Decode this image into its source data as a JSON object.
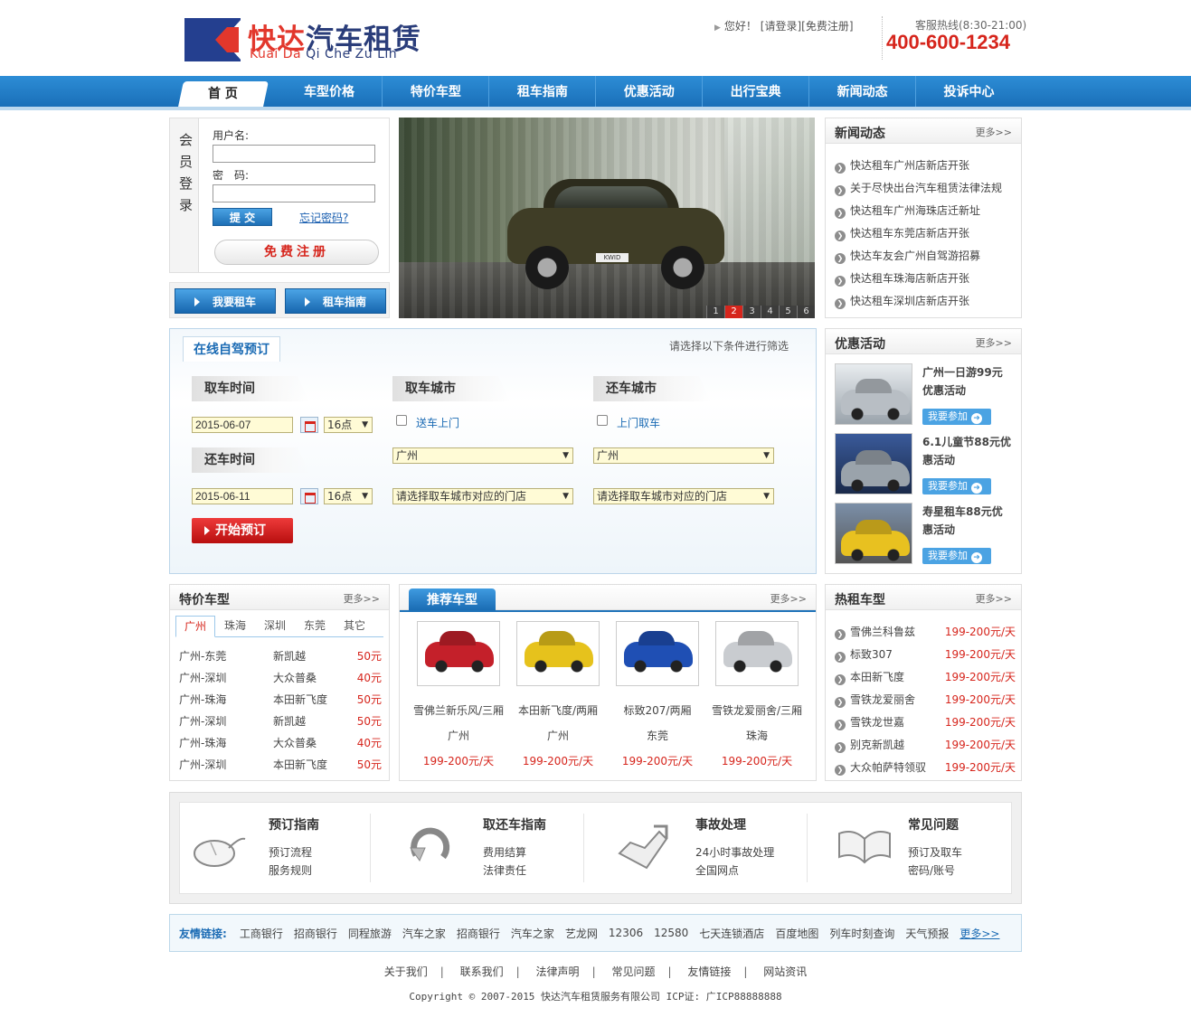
{
  "header": {
    "logo_cn_a": "快达",
    "logo_cn_b": "汽车租赁",
    "logo_en_a": "Kuai Da",
    "logo_en_b": "Qi Che Zu Lin",
    "greeting": "您好！",
    "login_link": "[请登录]",
    "register_link": "[免费注册]",
    "hotline_label": "客服热线(8:30-21:00)",
    "hotline_number": "400-600-1234"
  },
  "nav": [
    "首 页",
    "车型价格",
    "特价车型",
    "租车指南",
    "优惠活动",
    "出行宝典",
    "新闻动态",
    "投诉中心"
  ],
  "login": {
    "side_title": [
      "会",
      "员",
      "登",
      "录"
    ],
    "username_label": "用户名:",
    "password_label": "密　码:",
    "submit": "提 交",
    "forgot": "忘记密码?",
    "register": "免费注册"
  },
  "quick": {
    "rent": "我要租车",
    "guide": "租车指南"
  },
  "banner": {
    "plate": "KWID",
    "pages": [
      "1",
      "2",
      "3",
      "4",
      "5",
      "6"
    ],
    "active_page": "2"
  },
  "news": {
    "title": "新闻动态",
    "more": "更多>>",
    "items": [
      "快达租车广州店新店开张",
      "关于尽快出台汽车租赁法律法规",
      "快达租车广州海珠店迁新址",
      "快达租车东莞店新店开张",
      "快达车友会广州自驾游招募",
      "快达租车珠海店新店开张",
      "快达租车深圳店新店开张"
    ]
  },
  "promo": {
    "title": "优惠活动",
    "more": "更多>>",
    "join": "我要参加",
    "items": [
      "广州一日游99元优惠活动",
      "6.1儿童节88元优惠活动",
      "寿星租车88元优惠活动"
    ]
  },
  "booking": {
    "tab": "在线自驾预订",
    "hint": "请选择以下条件进行筛选",
    "pickup_time": "取车时间",
    "return_time": "还车时间",
    "pickup_city": "取车城市",
    "return_city": "还车城市",
    "pickup_date": "2015-06-07",
    "pickup_hour": "16点",
    "return_date": "2015-06-11",
    "return_hour": "16点",
    "deliver": "送车上门",
    "collect": "上门取车",
    "pickup_city_value": "广州",
    "return_city_value": "广州",
    "store_placeholder": "请选择取车城市对应的门店",
    "start": "开始预订"
  },
  "tejia": {
    "title": "特价车型",
    "more": "更多>>",
    "tabs": [
      "广州",
      "珠海",
      "深圳",
      "东莞",
      "其它"
    ],
    "rows": [
      {
        "route": "广州-东莞",
        "car": "新凯越",
        "price": "50元"
      },
      {
        "route": "广州-深圳",
        "car": "大众普桑",
        "price": "40元"
      },
      {
        "route": "广州-珠海",
        "car": "本田新飞度",
        "price": "50元"
      },
      {
        "route": "广州-深圳",
        "car": "新凯越",
        "price": "50元"
      },
      {
        "route": "广州-珠海",
        "car": "大众普桑",
        "price": "40元"
      },
      {
        "route": "广州-深圳",
        "car": "本田新飞度",
        "price": "50元"
      }
    ]
  },
  "recommend": {
    "title": "推荐车型",
    "more": "更多>>",
    "cars": [
      {
        "name": "雪佛兰新乐风/三厢",
        "city": "广州",
        "price": "199-200元/天",
        "color": "#c4202a"
      },
      {
        "name": "本田新飞度/两厢",
        "city": "广州",
        "price": "199-200元/天",
        "color": "#e6c21c"
      },
      {
        "name": "标致207/两厢",
        "city": "东莞",
        "price": "199-200元/天",
        "color": "#1f4fb4"
      },
      {
        "name": "雪铁龙爱丽舍/三厢",
        "city": "珠海",
        "price": "199-200元/天",
        "color": "#c9ccd0"
      }
    ]
  },
  "hot": {
    "title": "热租车型",
    "more": "更多>>",
    "items": [
      {
        "name": "雪佛兰科鲁兹",
        "price": "199-200元/天"
      },
      {
        "name": "标致307",
        "price": "199-200元/天"
      },
      {
        "name": "本田新飞度",
        "price": "199-200元/天"
      },
      {
        "name": "雪铁龙爱丽舍",
        "price": "199-200元/天"
      },
      {
        "name": "雪铁龙世嘉",
        "price": "199-200元/天"
      },
      {
        "name": "别克新凯越",
        "price": "199-200元/天"
      },
      {
        "name": "大众帕萨特领驭",
        "price": "199-200元/天"
      }
    ]
  },
  "guide": [
    {
      "title": "预订指南",
      "l1": "预订流程",
      "l2": "服务规则",
      "icon": "mouse-icon"
    },
    {
      "title": "取还车指南",
      "l1": "费用结算",
      "l2": "法律责任",
      "icon": "refresh-icon"
    },
    {
      "title": "事故处理",
      "l1": "24小时事故处理",
      "l2": "全国网点",
      "icon": "warning-icon"
    },
    {
      "title": "常见问题",
      "l1": "预订及取车",
      "l2": "密码/账号",
      "icon": "book-icon"
    }
  ],
  "friends": {
    "label": "友情链接:",
    "links": [
      "工商银行",
      "招商银行",
      "同程旅游",
      "汽车之家",
      "招商银行",
      "汽车之家",
      "艺龙网",
      "12306",
      "12580",
      "七天连锁酒店",
      "百度地图",
      "列车时刻查询",
      "天气预报"
    ],
    "more": "更多>>"
  },
  "footer": {
    "links": [
      "关于我们",
      "联系我们",
      "法律声明",
      "常见问题",
      "友情链接",
      "网站资讯"
    ],
    "copyright": "Copyright © 2007-2015 快达汽车租赁服务有限公司 ICP证: 广ICP88888888"
  }
}
